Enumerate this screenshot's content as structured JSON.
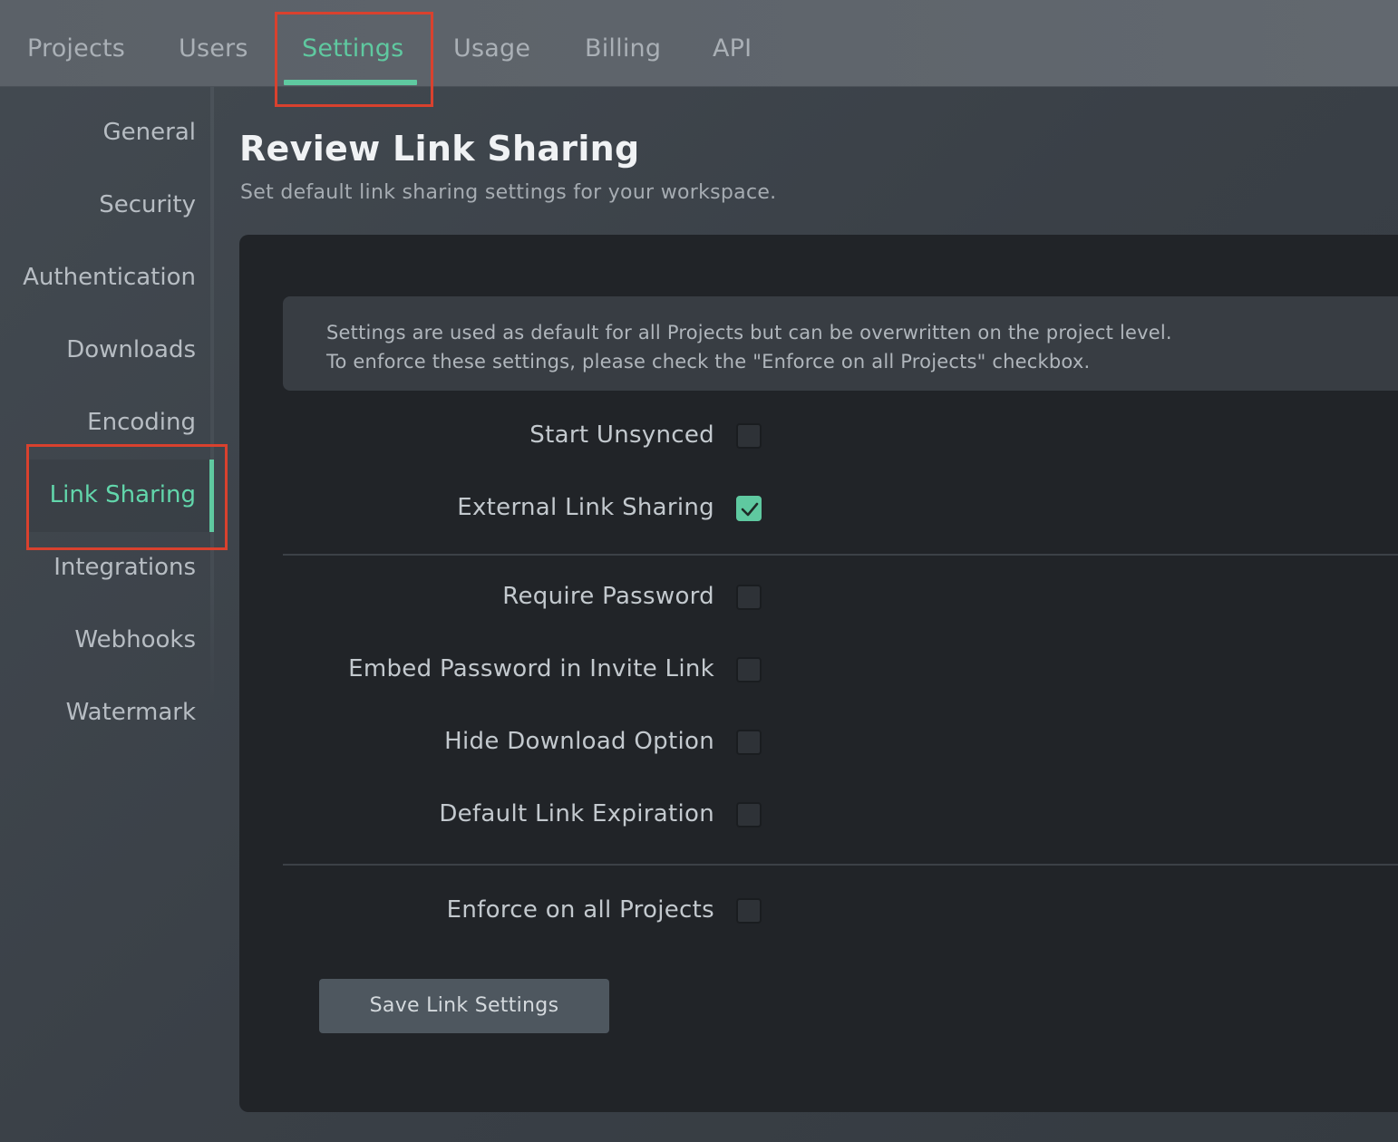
{
  "tabs": [
    {
      "label": "Projects",
      "active": false
    },
    {
      "label": "Users",
      "active": false
    },
    {
      "label": "Settings",
      "active": true
    },
    {
      "label": "Usage",
      "active": false
    },
    {
      "label": "Billing",
      "active": false
    },
    {
      "label": "API",
      "active": false
    }
  ],
  "sidebar": {
    "items": [
      {
        "label": "General",
        "active": false
      },
      {
        "label": "Security",
        "active": false
      },
      {
        "label": "Authentication",
        "active": false
      },
      {
        "label": "Downloads",
        "active": false
      },
      {
        "label": "Encoding",
        "active": false
      },
      {
        "label": "Link Sharing",
        "active": true
      },
      {
        "label": "Integrations",
        "active": false
      },
      {
        "label": "Webhooks",
        "active": false
      },
      {
        "label": "Watermark",
        "active": false
      }
    ]
  },
  "main": {
    "title": "Review Link Sharing",
    "subtitle": "Set default link sharing settings for your workspace.",
    "notice": {
      "line1": "Settings are used as default for all Projects but can be overwritten on the project level.",
      "line2": "To enforce these settings, please check the \"Enforce on all Projects\" checkbox."
    },
    "options": [
      {
        "label": "Start Unsynced",
        "checked": false
      },
      {
        "label": "External Link Sharing",
        "checked": true
      },
      {
        "label": "Require Password",
        "checked": false
      },
      {
        "label": "Embed Password in Invite Link",
        "checked": false
      },
      {
        "label": "Hide Download Option",
        "checked": false
      },
      {
        "label": "Default Link Expiration",
        "checked": false
      },
      {
        "label": "Enforce on all Projects",
        "checked": false
      }
    ],
    "save_label": "Save Link Settings"
  },
  "colors": {
    "accent": "#5fc9a0",
    "highlight": "#d9412e"
  }
}
